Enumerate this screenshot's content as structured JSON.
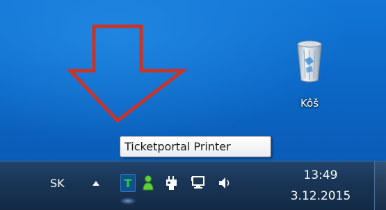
{
  "desktop": {
    "recycle_bin_label": "Kôš",
    "annotation_arrow_color": "#c8342a"
  },
  "tooltip": {
    "text": "Ticketportal Printer"
  },
  "taskbar": {
    "language": "SK",
    "tray_icons": [
      "show-hidden-icons-arrow",
      "ticketportal-printer-icon",
      "user-icon",
      "power-icon",
      "network-icon",
      "volume-icon"
    ],
    "ticketportal_letter": "T",
    "clock": {
      "time": "13:49",
      "date": "3.12.2015"
    }
  },
  "colors": {
    "desktop_blue": "#0c66c4",
    "taskbar": "#1a3656",
    "ticketportal_green": "#2ad03a"
  }
}
